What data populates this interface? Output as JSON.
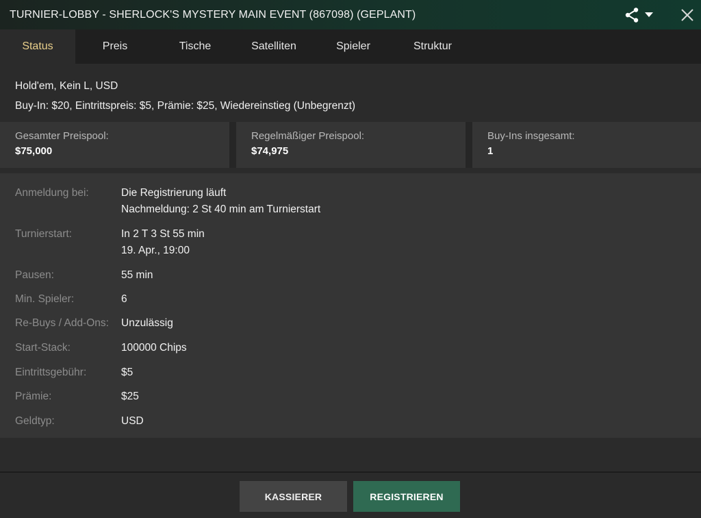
{
  "window": {
    "title": "TURNIER-LOBBY - SHERLOCK'S MYSTERY MAIN EVENT (867098) (GEPLANT)"
  },
  "icons": {
    "share": "share-icon",
    "dropdown": "caret-down-icon",
    "close": "close-icon"
  },
  "tabs": [
    {
      "label": "Status",
      "active": true
    },
    {
      "label": "Preis",
      "active": false
    },
    {
      "label": "Tische",
      "active": false
    },
    {
      "label": "Satelliten",
      "active": false
    },
    {
      "label": "Spieler",
      "active": false
    },
    {
      "label": "Struktur",
      "active": false
    }
  ],
  "summary": {
    "game": "Hold'em, Kein L, USD",
    "fees": "Buy-In: $20, Eintrittspreis: $5, Prämie: $25, Wiedereinstieg (Unbegrenzt)"
  },
  "cards": [
    {
      "label": "Gesamter Preispool:",
      "value": "$75,000"
    },
    {
      "label": "Regelmäßiger Preispool:",
      "value": "$74,975"
    },
    {
      "label": "Buy-Ins insgesamt:",
      "value": "1"
    }
  ],
  "details": [
    {
      "label": "Anmeldung bei:",
      "lines": [
        "Die Registrierung läuft",
        "Nachmeldung: 2 St 40 min am Turnierstart"
      ]
    },
    {
      "label": "Turnierstart:",
      "lines": [
        "In 2 T 3 St 55 min",
        "19. Apr., 19:00"
      ]
    },
    {
      "label": "Pausen:",
      "lines": [
        "55 min"
      ]
    },
    {
      "label": "Min. Spieler:",
      "lines": [
        "6"
      ]
    },
    {
      "label": "Re-Buys / Add-Ons:",
      "lines": [
        "Unzulässig"
      ]
    },
    {
      "label": "Start-Stack:",
      "lines": [
        "100000 Chips"
      ]
    },
    {
      "label": "Eintrittsgebühr:",
      "lines": [
        "$5"
      ]
    },
    {
      "label": "Prämie:",
      "lines": [
        "$25"
      ]
    },
    {
      "label": "Geldtyp:",
      "lines": [
        "USD"
      ]
    }
  ],
  "footer": {
    "cashier_label": "KASSIERER",
    "register_label": "REGISTRIEREN"
  },
  "colors": {
    "accent_tab": "#e9cf8b",
    "register_button": "#2f6a52"
  }
}
